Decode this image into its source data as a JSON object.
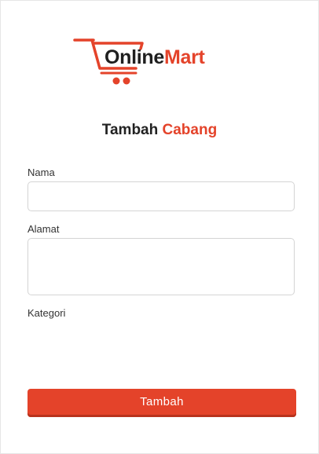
{
  "brand": {
    "part1": "Online",
    "part2": "Mart",
    "accent_color": "#e4432a",
    "dark_color": "#1f1f1f",
    "icon": "shopping-cart-icon"
  },
  "page": {
    "title_part1": "Tambah",
    "title_part2": "Cabang"
  },
  "form": {
    "nama": {
      "label": "Nama",
      "value": ""
    },
    "alamat": {
      "label": "Alamat",
      "value": ""
    },
    "kategori": {
      "label": "Kategori"
    },
    "submit_label": "Tambah"
  }
}
